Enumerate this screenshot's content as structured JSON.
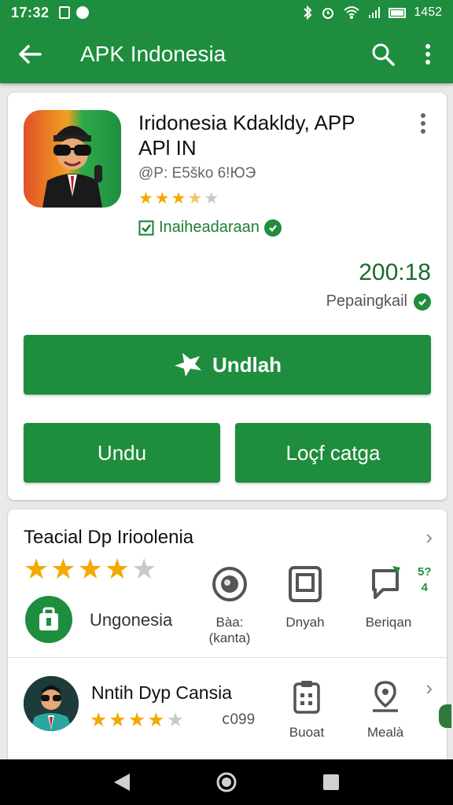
{
  "status_bar": {
    "time": "17:32",
    "right_text": "1452"
  },
  "app_bar": {
    "title": "APK Indonesia",
    "icons": [
      "back-arrow-icon",
      "search-icon",
      "more-vert-icon"
    ]
  },
  "app_card": {
    "name": "Iridonesia Kdakldy, APP APl IN",
    "id_text": "@P: E5ško 6!ЮЭ",
    "rating_stars": 3.5,
    "verified_label": "Inaiheadaraan",
    "count": "200:18",
    "count_label": "Pepaingkail",
    "primary_button": "Undlah",
    "secondary_buttons": [
      "Undu",
      "Loçf catga"
    ]
  },
  "details_card": {
    "section_title": "Teacial Dp Irioolenia",
    "rating_stars": 4,
    "developer_label": "Ungonesia",
    "features": [
      {
        "label": "Bàa:\n(kanta)",
        "icon": "radio-icon"
      },
      {
        "label": "Dnyah",
        "icon": "tablet-icon"
      },
      {
        "label": "Beriqan",
        "icon": "chat-bubble-icon",
        "badge": "5?4"
      }
    ],
    "second_item": {
      "name": "Nntih Dyp Cansia",
      "rating_stars": 4,
      "count": "ⅽ099",
      "features": [
        {
          "label": "Buoat",
          "icon": "clipboard-icon"
        },
        {
          "label": "Mealà",
          "icon": "location-pin-icon"
        }
      ]
    }
  },
  "colors": {
    "primary": "#1e8e3e",
    "star": "#f2a900",
    "background": "#e9e9e9"
  }
}
